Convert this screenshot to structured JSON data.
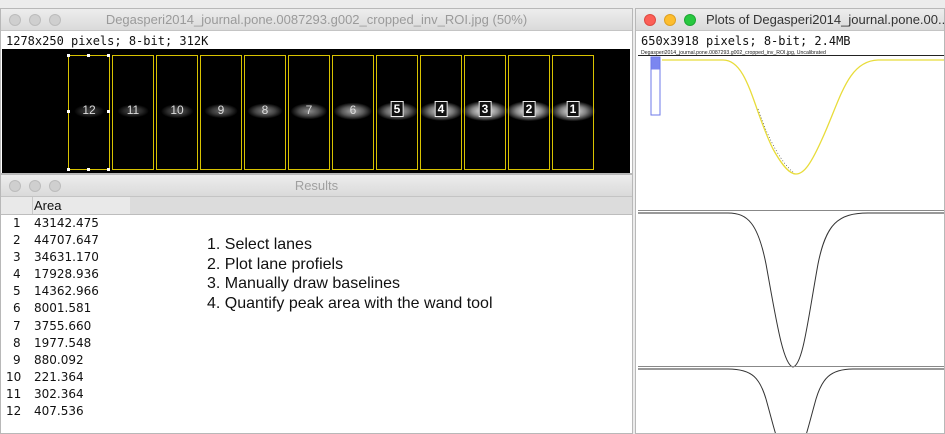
{
  "image_window": {
    "title": "Degasperi2014_journal.pone.0087293.g002_cropped_inv_ROI.jpg (50%)",
    "info": "1278x250 pixels; 8-bit; 312K",
    "lanes": [
      {
        "label": "12",
        "boxed": false,
        "intensity": 0.25
      },
      {
        "label": "11",
        "boxed": false,
        "intensity": 0.3
      },
      {
        "label": "10",
        "boxed": false,
        "intensity": 0.35
      },
      {
        "label": "9",
        "boxed": false,
        "intensity": 0.4
      },
      {
        "label": "8",
        "boxed": false,
        "intensity": 0.5
      },
      {
        "label": "7",
        "boxed": false,
        "intensity": 0.55
      },
      {
        "label": "6",
        "boxed": false,
        "intensity": 0.65
      },
      {
        "label": "5",
        "boxed": true,
        "intensity": 0.75
      },
      {
        "label": "4",
        "boxed": true,
        "intensity": 0.85
      },
      {
        "label": "3",
        "boxed": true,
        "intensity": 1.0
      },
      {
        "label": "2",
        "boxed": true,
        "intensity": 1.0
      },
      {
        "label": "1",
        "boxed": true,
        "intensity": 0.95
      }
    ]
  },
  "results_window": {
    "title": "Results",
    "column": "Area",
    "rows": [
      {
        "index": "1",
        "area": "43142.475"
      },
      {
        "index": "2",
        "area": "44707.647"
      },
      {
        "index": "3",
        "area": "34631.170"
      },
      {
        "index": "4",
        "area": "17928.936"
      },
      {
        "index": "5",
        "area": "14362.966"
      },
      {
        "index": "6",
        "area": "8001.581"
      },
      {
        "index": "7",
        "area": "3755.660"
      },
      {
        "index": "8",
        "area": "1977.548"
      },
      {
        "index": "9",
        "area": "880.092"
      },
      {
        "index": "10",
        "area": "221.364"
      },
      {
        "index": "11",
        "area": "302.364"
      },
      {
        "index": "12",
        "area": "407.536"
      }
    ],
    "steps": [
      "1. Select lanes",
      "2. Plot lane profiels",
      "3. Manually draw baselines",
      "4. Quantify peak area with the wand tool"
    ]
  },
  "plots_window": {
    "title": "Plots of Degasperi2014_journal.pone.00...",
    "info": "650x3918 pixels; 8-bit; 2.4MB",
    "plot_caption": "Degasperi2014_journal.pone.0087293.g002_cropped_inv_ROI.jpg, Uncalibrated",
    "colors": {
      "first_profile": "#e8dc3a",
      "profile": "#333333",
      "selection": "#7b86f0"
    }
  }
}
